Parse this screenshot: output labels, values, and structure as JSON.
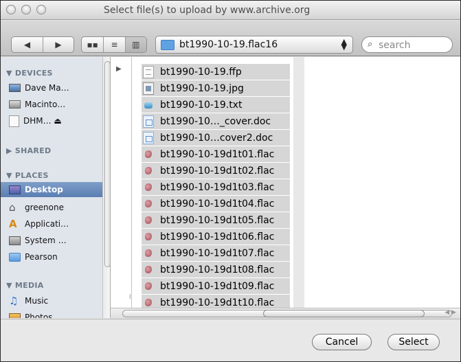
{
  "window": {
    "title": "Select file(s) to upload by www.archive.org"
  },
  "toolbar": {
    "back_icon": "back-arrow-icon",
    "forward_icon": "forward-arrow-icon",
    "view_icons": [
      "icon-view-icon",
      "list-view-icon",
      "column-view-icon"
    ],
    "path_folder": "bt1990-10-19.flac16",
    "search_placeholder": "search"
  },
  "sidebar": {
    "devices_header": "DEVICES",
    "devices": [
      {
        "label": "Dave Ma…",
        "icon": "computer-icon"
      },
      {
        "label": "Macinto…",
        "icon": "hard-drive-icon"
      },
      {
        "label": "DHM… ⏏",
        "icon": "disk-icon"
      }
    ],
    "shared_header": "SHARED",
    "places_header": "PLACES",
    "places": [
      {
        "label": "Desktop",
        "icon": "desktop-icon",
        "selected": true
      },
      {
        "label": "greenone",
        "icon": "home-icon"
      },
      {
        "label": "Applicati…",
        "icon": "applications-icon"
      },
      {
        "label": "System …",
        "icon": "system-icon"
      },
      {
        "label": "Pearson",
        "icon": "folder-icon"
      }
    ],
    "media_header": "MEDIA",
    "media": [
      {
        "label": "Music",
        "icon": "music-icon"
      },
      {
        "label": "Photos",
        "icon": "photos-icon"
      }
    ]
  },
  "files": [
    {
      "name": "bt1990-10-19.ffp",
      "type": "doc"
    },
    {
      "name": "bt1990-10-19.jpg",
      "type": "jpg"
    },
    {
      "name": "bt1990-10-19.txt",
      "type": "txt"
    },
    {
      "name": "bt1990-10…_cover.doc",
      "type": "word"
    },
    {
      "name": "bt1990-10…cover2.doc",
      "type": "word"
    },
    {
      "name": "bt1990-10-19d1t01.flac",
      "type": "flac"
    },
    {
      "name": "bt1990-10-19d1t02.flac",
      "type": "flac"
    },
    {
      "name": "bt1990-10-19d1t03.flac",
      "type": "flac"
    },
    {
      "name": "bt1990-10-19d1t04.flac",
      "type": "flac"
    },
    {
      "name": "bt1990-10-19d1t05.flac",
      "type": "flac"
    },
    {
      "name": "bt1990-10-19d1t06.flac",
      "type": "flac"
    },
    {
      "name": "bt1990-10-19d1t07.flac",
      "type": "flac"
    },
    {
      "name": "bt1990-10-19d1t08.flac",
      "type": "flac"
    },
    {
      "name": "bt1990-10-19d1t09.flac",
      "type": "flac"
    },
    {
      "name": "bt1990-10-19d1t10.flac",
      "type": "flac"
    }
  ],
  "footer": {
    "cancel_label": "Cancel",
    "select_label": "Select"
  }
}
